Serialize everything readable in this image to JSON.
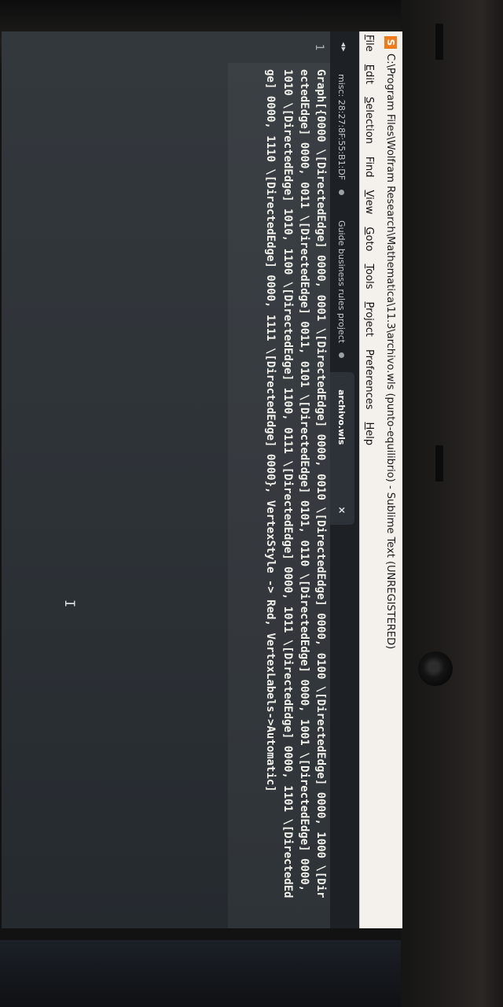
{
  "window": {
    "title": "C:\\Program Files\\Wolfram Research\\Mathematica\\11.3\\archivo.wls (punto-equilibrio) - Sublime Text (UNREGISTERED)",
    "logo_glyph": "S"
  },
  "menu": [
    {
      "accel": "F",
      "rest": "ile"
    },
    {
      "accel": "E",
      "rest": "dit"
    },
    {
      "accel": "S",
      "rest": "election"
    },
    {
      "accel": "",
      "rest": "Find"
    },
    {
      "accel": "V",
      "rest": "iew"
    },
    {
      "accel": "G",
      "rest": "oto"
    },
    {
      "accel": "T",
      "rest": "ools"
    },
    {
      "accel": "P",
      "rest": "roject"
    },
    {
      "accel": "",
      "rest": "Preferences"
    },
    {
      "accel": "H",
      "rest": "elp"
    }
  ],
  "nav_arrows": "◂▸",
  "tabs": [
    {
      "label": "misc: 28:27:8F:55:B1:DF",
      "active": false
    },
    {
      "label": "Guide business rules project",
      "active": false
    },
    {
      "label": "archivo.wls",
      "active": true,
      "close_glyph": "×"
    }
  ],
  "editor": {
    "line_number": "1",
    "code": "Graph[{0000 \\[DirectedEdge] 0000, 0001 \\[DirectedEdge] 0000, 0010 \\[DirectedEdge] 0000, 0100 \\[DirectedEdge] 0000, 1000 \\[DirectedEdge] 0000, 0011 \\[DirectedEdge] 0011, 0101 \\[DirectedEdge] 0101, 0110 \\[DirectedEdge] 0000, 1001 \\[DirectedEdge] 0000, 1010 \\[DirectedEdge] 1010, 1100 \\[DirectedEdge] 1100, 0111 \\[DirectedEdge] 0000, 1011 \\[DirectedEdge] 0000, 1101 \\[DirectedEdge] 0000, 1110 \\[DirectedEdge] 0000, 1111 \\[DirectedEdge] 0000}, VertexStyle -> Red, VertexLabels->Automatic]",
    "mouse_cursor_glyph": "I"
  }
}
